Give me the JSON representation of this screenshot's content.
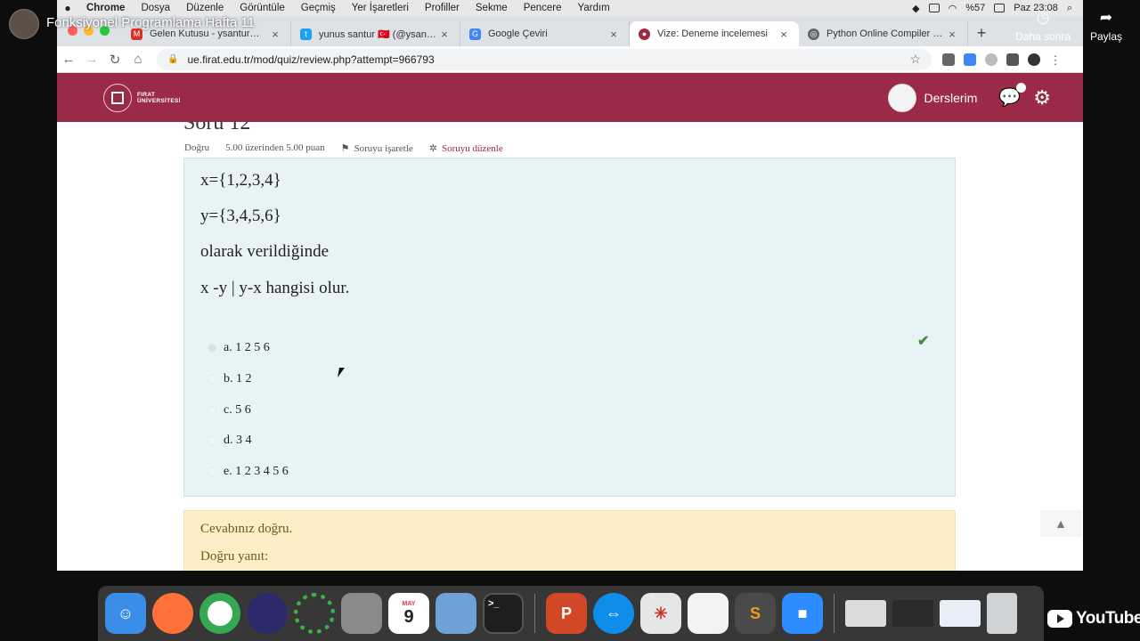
{
  "youtube": {
    "video_title": "Fonksiyonel Programlama Hafta 11",
    "watch_later_label": "Daha sonra",
    "share_label": "Paylaş",
    "logo_text": "YouTube"
  },
  "menubar": {
    "items": [
      "Chrome",
      "Dosya",
      "Düzenle",
      "Görüntüle",
      "Geçmiş",
      "Yer İşaretleri",
      "Profiller",
      "Sekme",
      "Pencere",
      "Yardım"
    ],
    "battery": "%57",
    "clock": "Paz 23:08"
  },
  "tabs": [
    {
      "title": "Gelen Kutusu - ysantur@gmail",
      "favicon": "gmail-icon",
      "color": "#d93025"
    },
    {
      "title": "yunus santur 🇹🇷 (@ysantur) / T",
      "favicon": "twitter-icon",
      "color": "#1da1f2"
    },
    {
      "title": "Google Çeviri",
      "favicon": "translate-icon",
      "color": "#4285f4"
    },
    {
      "title": "Vize: Deneme incelemesi",
      "favicon": "moodle-icon",
      "color": "#9b2a46"
    },
    {
      "title": "Python Online Compiler & Inter",
      "favicon": "python-icon",
      "color": "#666666"
    }
  ],
  "address": {
    "url": "ue.firat.edu.tr/mod/quiz/review.php?attempt=966793"
  },
  "header": {
    "logo_line1": "FIRAT",
    "logo_line2": "ÜNİVERSİTESİ",
    "courses_label": "Derslerim",
    "brand_color": "#9b2a46"
  },
  "question": {
    "heading": "Soru 12",
    "status": "Doğru",
    "grade": "5.00 üzerinden 5.00 puan",
    "flag_label": "Soruyu işaretle",
    "edit_label": "Soruyu düzenle",
    "lines": [
      "x={1,2,3,4}",
      "y={3,4,5,6}",
      "olarak verildiğinde",
      "x -y | y-x hangisi olur."
    ],
    "answers": [
      {
        "label": "a. 1 2 5 6",
        "checked": true
      },
      {
        "label": "b. 1 2",
        "checked": false
      },
      {
        "label": "c. 5 6",
        "checked": false
      },
      {
        "label": "d. 3 4",
        "checked": false
      },
      {
        "label": "e. 1 2 3 4 5 6",
        "checked": false
      }
    ]
  },
  "feedback": {
    "result": "Cevabınız doğru.",
    "correct_answer_label": "Doğru yanıt:"
  },
  "dock": {
    "apps": [
      {
        "name": "finder-icon",
        "color": "#3b8ee8"
      },
      {
        "name": "firefox-icon",
        "color": "#ff7139"
      },
      {
        "name": "chrome-icon",
        "color": "#ffffff"
      },
      {
        "name": "siri-icon",
        "color": "#2b2b6b"
      },
      {
        "name": "activity-ring-icon",
        "color": "#2f8f3a"
      },
      {
        "name": "remote-desktop-icon",
        "color": "#8a8a8a"
      },
      {
        "name": "calendar-icon",
        "color": "#ffffff"
      },
      {
        "name": "preview-icon",
        "color": "#6fa0d8"
      },
      {
        "name": "terminal-icon",
        "color": "#1e1e1e"
      },
      {
        "name": "powerpoint-icon",
        "color": "#d24726"
      },
      {
        "name": "teamviewer-icon",
        "color": "#0e8ee9"
      },
      {
        "name": "spider-web-icon",
        "color": "#e6e6e6"
      },
      {
        "name": "textedit-icon",
        "color": "#f3f3f3"
      },
      {
        "name": "sublime-text-icon",
        "color": "#4a4a4a"
      },
      {
        "name": "zoom-icon",
        "color": "#2d8cff"
      },
      {
        "name": "screenshot-thumb-1-icon",
        "color": "#dcdcdc"
      },
      {
        "name": "screenshot-thumb-2-icon",
        "color": "#2a2a2a"
      },
      {
        "name": "screenshot-thumb-3-icon",
        "color": "#e8eef8"
      },
      {
        "name": "trash-icon",
        "color": "#cfd3d6"
      }
    ],
    "calendar_month": "MAY",
    "calendar_day": "9"
  }
}
